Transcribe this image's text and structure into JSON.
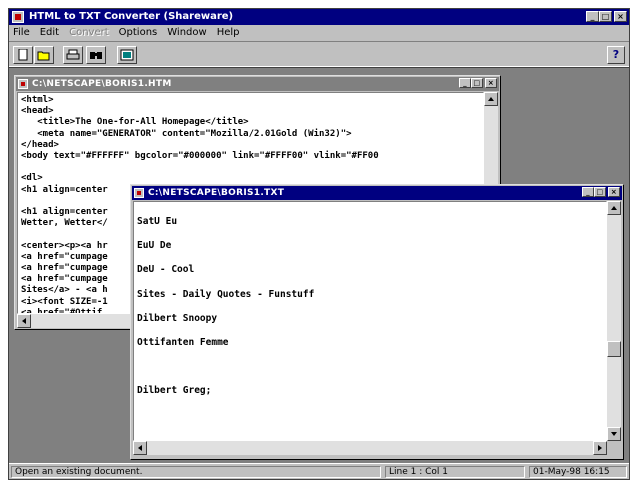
{
  "app": {
    "title": "HTML to TXT Converter (Shareware)",
    "menu": [
      "File",
      "Edit",
      "Convert",
      "Options",
      "Window",
      "Help"
    ],
    "menu_disabled": [
      "Convert"
    ],
    "help_button": "?"
  },
  "toolbar": {
    "buttons": [
      "new-icon",
      "open-icon",
      "print-icon",
      "find-icon",
      "convert-icon"
    ]
  },
  "windows": {
    "html": {
      "title": "C:\\NETSCAPE\\BORIS1.HTM",
      "lines": [
        "<html>",
        "<head>",
        "   <title>The One-for-All Homepage</title>",
        "   <meta name=\"GENERATOR\" content=\"Mozilla/2.01Gold (Win32)\">",
        "</head>",
        "<body text=\"#FFFFFF\" bgcolor=\"#000000\" link=\"#FFFF00\" vlink=\"#FF00",
        "",
        "<dl>",
        "<h1 align=center",
        "",
        "<h1 align=center",
        "Wetter, Wetter</",
        "",
        "<center><p><a hr",
        "<a href=\"cumpage",
        "<a href=\"cumpage",
        "<a href=\"cumpage",
        "Sites</a> - <a h",
        "<i><font SIZE=-1",
        "<a href=\"#Ottif"
      ]
    },
    "txt": {
      "title": "C:\\NETSCAPE\\BORIS1.TXT",
      "lines": [
        "",
        "SatU Eu",
        "",
        "EuU De",
        "",
        "DeU - Cool",
        "",
        "Sites - Daily Quotes - Funstuff",
        "",
        "Dilbert Snoopy",
        "",
        "Ottifanten Femme",
        "",
        "",
        "",
        "Dilbert Greg;"
      ]
    }
  },
  "status": {
    "message": "Open an existing document.",
    "position": "Line 1 : Col 1",
    "datetime": "01-May-98 16:15"
  },
  "colors": {
    "active_title": "#000080",
    "inactive_title": "#808080",
    "face": "#c0c0c0"
  }
}
